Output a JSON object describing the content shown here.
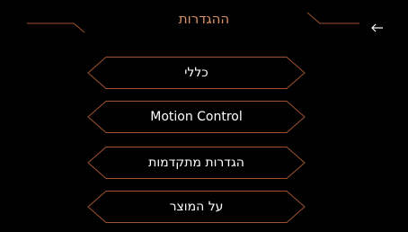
{
  "header": {
    "title": "ההגדרות",
    "back_icon": "arrow-left-icon"
  },
  "menu": {
    "items": [
      {
        "label": "כללי",
        "rtl": true
      },
      {
        "label": "Motion Control",
        "rtl": false
      },
      {
        "label": "הגדרות מתקדמות",
        "rtl": true
      },
      {
        "label": "על המוצר",
        "rtl": true
      }
    ]
  },
  "colors": {
    "accent": "#d9926a",
    "line": "#a0522d",
    "background": "#000000"
  }
}
